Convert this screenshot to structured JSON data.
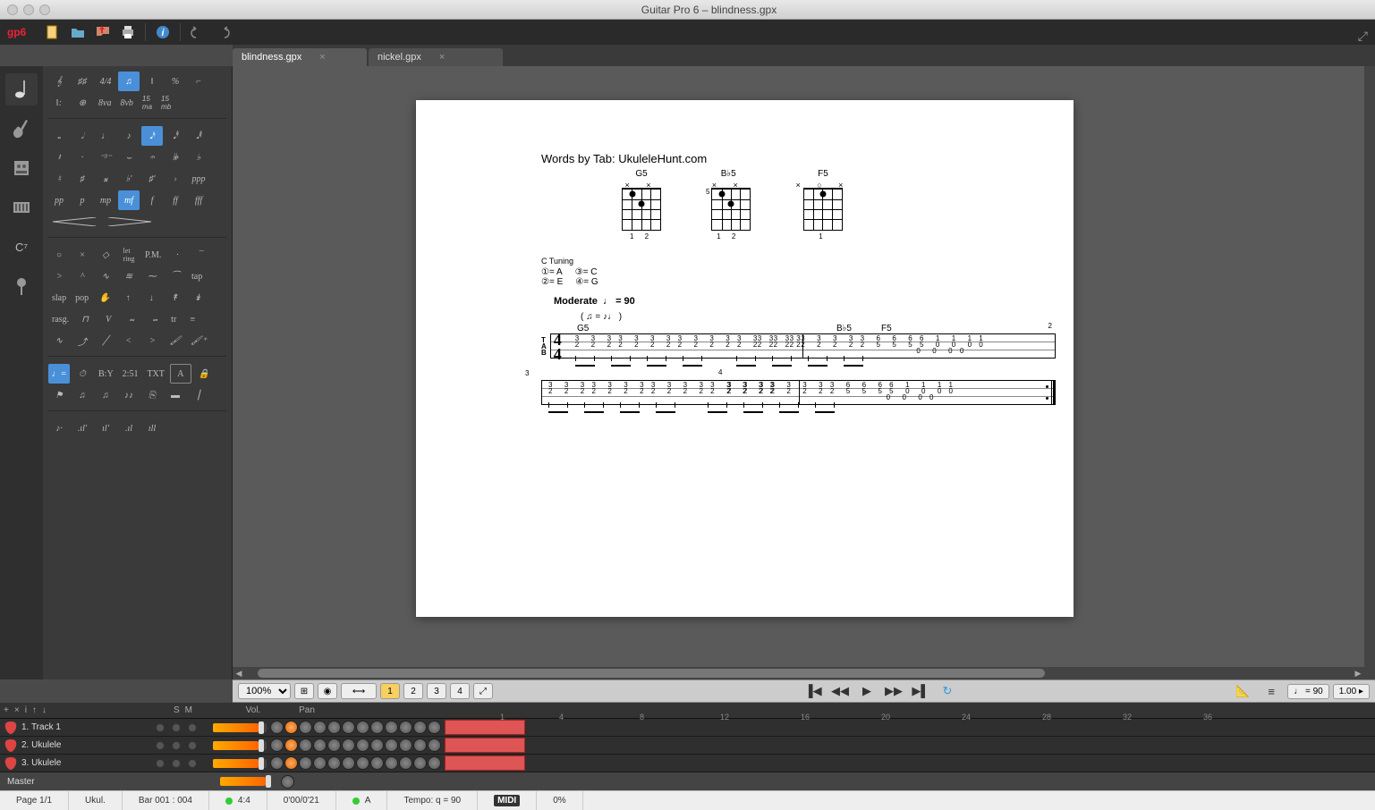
{
  "window": {
    "title": "Guitar Pro 6 – blindness.gpx"
  },
  "logo": {
    "app": "gp",
    "ver": "6"
  },
  "tabs": [
    {
      "name": "blindness.gpx",
      "active": true
    },
    {
      "name": "nickel.gpx",
      "active": false
    }
  ],
  "palette": {
    "dynamics": [
      "ppp",
      "pp",
      "p",
      "mp",
      "mf",
      "f",
      "ff",
      "fff"
    ],
    "selected_dynamic": "mf",
    "text_row": [
      "B:Y",
      "2:51",
      "TXT",
      "A"
    ],
    "effects": [
      "P.M.",
      "let ring"
    ],
    "strum": [
      "tap",
      "slap",
      "pop"
    ],
    "rasg": "rasg."
  },
  "score": {
    "credit": "Words by Tab: UkuleleHunt.com",
    "chords": [
      {
        "name": "G5",
        "top": "×      ×",
        "bot": " 1 2",
        "dots": [
          [
            25,
            12
          ],
          [
            50,
            36
          ]
        ]
      },
      {
        "name": "B♭5",
        "top": "×      ×",
        "bot": " 1 2",
        "dots": [
          [
            25,
            12
          ],
          [
            50,
            36
          ]
        ],
        "side": "5"
      },
      {
        "name": "F5",
        "top": "× ○    ×",
        "bot": "  1",
        "dots": [
          [
            50,
            12
          ]
        ]
      }
    ],
    "tuning": {
      "title": "C Tuning",
      "pairs": [
        "①= A",
        "③= C",
        "②= E",
        "④= G"
      ]
    },
    "tempo": {
      "label": "Moderate",
      "value": "= 90"
    },
    "swing": "( ♫ = ♪♩ )",
    "bar_chord_labels": [
      "G5",
      "B♭5",
      "F5"
    ],
    "tab_bars": [
      {
        "measures": [
          {
            "nums_top": "3  3  3 3  3  3  3 3  3  3  3 3  3  3  3 3",
            "nums_mid": "2  2  2 2  2  2  2 2  2  2  2 2  2  2  2 2"
          },
          {
            "nums_top": "3  3  3 3  3  3  3 3  6  6  6 6  1  1  1 1",
            "nums_mid": "2  2  2 2  2  2  2 2  5  5  5 5  0  0  0 0",
            "nums_bot": "                                  0  0  0 0"
          }
        ],
        "show_clef": true,
        "show_time": true
      },
      {
        "measures": [
          {
            "nums_top": "3  3  3 3  3  3  3 3  3  3  3 3  3  3  3 3",
            "nums_mid": "2  2  2 2  2  2  2 2  2  2  2 2  2  2  2 2"
          },
          {
            "nums_top": "3  3  3 3  3  3  3 3  6  6  6 6  1  1  1 1",
            "nums_mid": "2  2  2 2  2  2  2 2  5  5  5 5  0  0  0 0",
            "nums_bot": "                                  0  0  0 0",
            "repeat_end": true
          }
        ],
        "show_clef": false,
        "show_time": false,
        "bar_start": "3",
        "bar_mid": "4"
      }
    ]
  },
  "viewbar": {
    "zoom": "100%",
    "pages": [
      "1",
      "2",
      "3",
      "4"
    ],
    "tempo_display": "♩ = 90",
    "speed": "1.00"
  },
  "track_header": {
    "buttons": [
      "+",
      "×",
      "i",
      "↑",
      "↓"
    ],
    "sm": [
      "S",
      "M"
    ],
    "vol": "Vol.",
    "pan": "Pan",
    "ticks": [
      1,
      4,
      8,
      12,
      16,
      20,
      24,
      28,
      32,
      36
    ]
  },
  "tracks": [
    {
      "label": "1. Track 1",
      "vol": 85,
      "clip_start": 0,
      "clip_end": 90
    },
    {
      "label": "2. Ukulele",
      "vol": 85,
      "clip_start": 0,
      "clip_end": 90
    },
    {
      "label": "3. Ukulele",
      "vol": 85,
      "clip_start": 0,
      "clip_end": 90
    }
  ],
  "master": {
    "label": "Master",
    "vol": 85
  },
  "status": {
    "page": "Page 1/1",
    "instrument": "Ukul.",
    "bar": "Bar 001 : 004",
    "time_sig": "4:4",
    "duration": "0'00/0'21",
    "key": "A",
    "tempo": "Tempo: q = 90",
    "midi": "MIDI",
    "pct": "0%"
  }
}
